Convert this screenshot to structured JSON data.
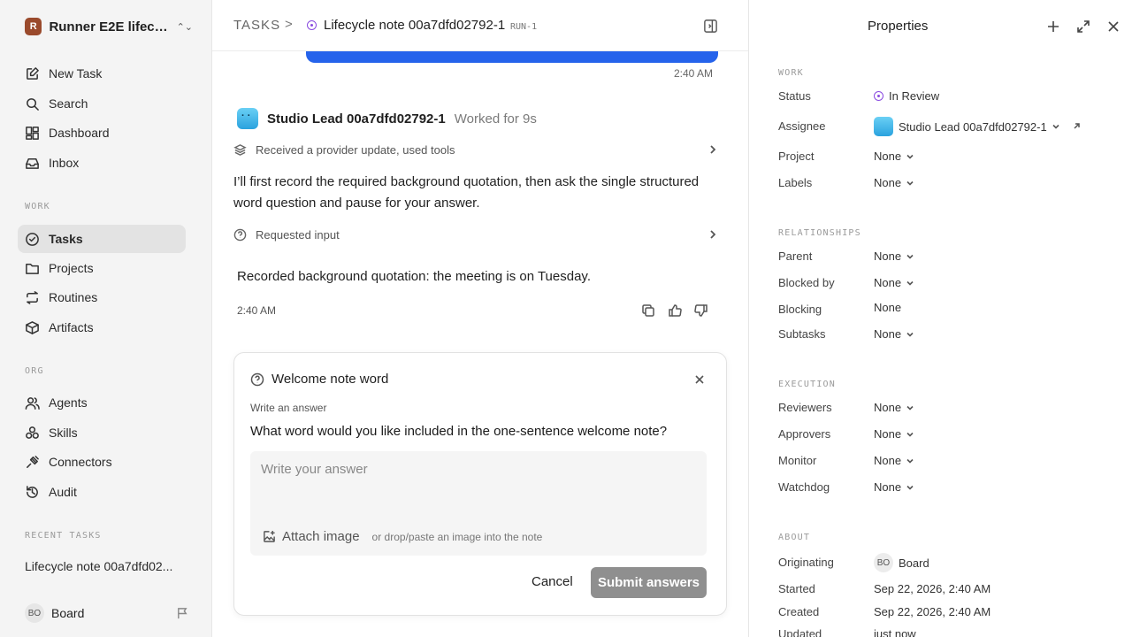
{
  "sidebar": {
    "workspace": {
      "logo": "R",
      "name": "Runner E2E lifecy..."
    },
    "top_items": [
      {
        "label": "New Task",
        "icon": "new-task-icon"
      },
      {
        "label": "Search",
        "icon": "search-icon"
      },
      {
        "label": "Dashboard",
        "icon": "dashboard-icon"
      },
      {
        "label": "Inbox",
        "icon": "inbox-icon"
      }
    ],
    "work_label": "WORK",
    "work_items": [
      {
        "label": "Tasks",
        "icon": "check-circle-icon",
        "active": true
      },
      {
        "label": "Projects",
        "icon": "folder-icon"
      },
      {
        "label": "Routines",
        "icon": "repeat-icon"
      },
      {
        "label": "Artifacts",
        "icon": "box-icon"
      }
    ],
    "org_label": "ORG",
    "org_items": [
      {
        "label": "Agents",
        "icon": "users-icon"
      },
      {
        "label": "Skills",
        "icon": "skills-icon"
      },
      {
        "label": "Connectors",
        "icon": "plug-icon"
      },
      {
        "label": "Audit",
        "icon": "history-icon"
      }
    ],
    "recent_label": "RECENT TASKS",
    "recent_items": [
      "Lifecycle note 00a7dfd02..."
    ],
    "user": {
      "initials": "BO",
      "name": "Board"
    }
  },
  "header": {
    "root": "TASKS",
    "separator": ">",
    "title": "Lifecycle note 00a7dfd02792-1",
    "run_badge": "RUN-1"
  },
  "conversation": {
    "sent_time": "2:40 AM",
    "agent_name": "Studio Lead 00a7dfd02792-1",
    "agent_meta": "Worked for 9s",
    "step1": "Received a provider update, used tools",
    "message": "I’ll first record the required background quotation, then ask the single structured word question and pause for your answer.",
    "step2": "Requested input",
    "quote": "Recorded background quotation: the meeting is on Tuesday.",
    "reply_time": "2:40 AM"
  },
  "question_card": {
    "title": "Welcome note word",
    "subtitle": "Write an answer",
    "question": "What word would you like included in the one-sentence welcome note?",
    "placeholder": "Write your answer",
    "attach_label": "Attach image",
    "attach_hint": "or drop/paste an image into the note",
    "cancel_label": "Cancel",
    "submit_label": "Submit answers"
  },
  "properties": {
    "title": "Properties",
    "work_label": "WORK",
    "status_label": "Status",
    "status_value": "In Review",
    "assignee_label": "Assignee",
    "assignee_value": "Studio Lead 00a7dfd02792-1",
    "project_label": "Project",
    "project_value": "None",
    "labels_label": "Labels",
    "labels_value": "None",
    "relationships_label": "RELATIONSHIPS",
    "parent_label": "Parent",
    "parent_value": "None",
    "blocked_by_label": "Blocked by",
    "blocked_by_value": "None",
    "blocking_label": "Blocking",
    "blocking_value": "None",
    "subtasks_label": "Subtasks",
    "subtasks_value": "None",
    "execution_label": "EXECUTION",
    "reviewers_label": "Reviewers",
    "reviewers_value": "None",
    "approvers_label": "Approvers",
    "approvers_value": "None",
    "monitor_label": "Monitor",
    "monitor_value": "None",
    "watchdog_label": "Watchdog",
    "watchdog_value": "None",
    "about_label": "ABOUT",
    "originating_label": "Originating",
    "originating_initials": "BO",
    "originating_value": "Board",
    "started_label": "Started",
    "started_value": "Sep 22, 2026, 2:40 AM",
    "created_label": "Created",
    "created_value": "Sep 22, 2026, 2:40 AM",
    "updated_label": "Updated",
    "updated_value": "just now"
  },
  "colors": {
    "accent_blue": "#2563eb",
    "status_purple": "#8a4be0",
    "submit_disabled": "#8f8f8f"
  }
}
